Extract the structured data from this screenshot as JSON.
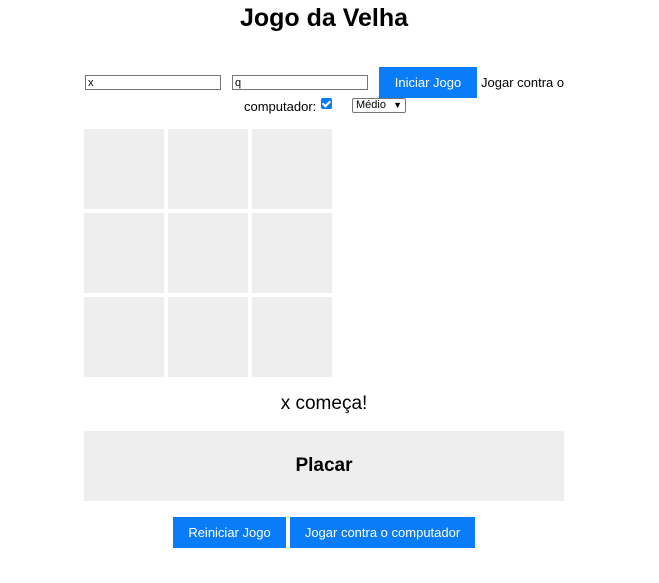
{
  "title": "Jogo da Velha",
  "setup": {
    "player1_value": "x",
    "player2_value": "q",
    "start_label": "Iniciar Jogo",
    "vs_computer_label_1": "Jogar contra o",
    "vs_computer_label_2": "computador:",
    "vs_computer_checked": true,
    "difficulty_selected": "Médio"
  },
  "board": {
    "cells": [
      "",
      "",
      "",
      "",
      "",
      "",
      "",
      "",
      ""
    ]
  },
  "status": "x começa!",
  "scoreboard": {
    "title": "Placar"
  },
  "actions": {
    "restart_label": "Reiniciar Jogo",
    "vs_computer_label": "Jogar contra o computador"
  },
  "colors": {
    "accent": "#0a7cf7",
    "panel": "#eeeeee"
  }
}
